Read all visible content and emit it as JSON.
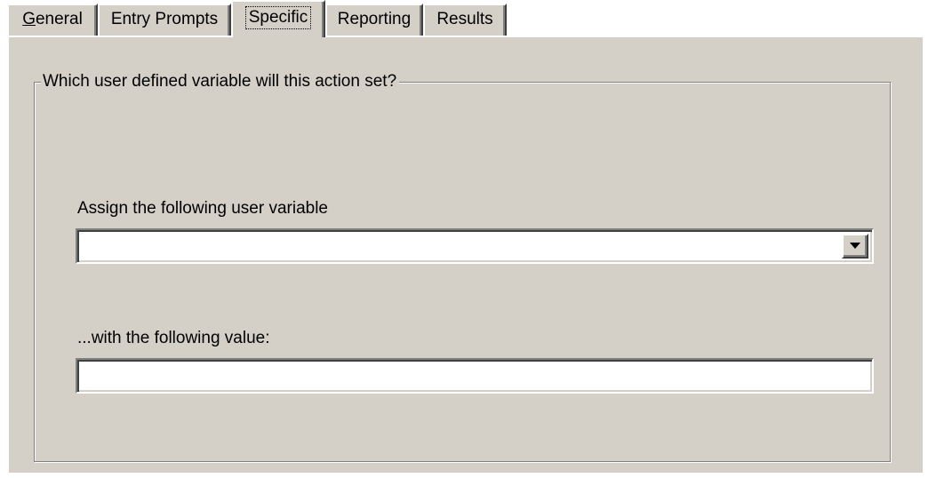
{
  "tabs": [
    {
      "label": "General",
      "selected": false,
      "underlined_letter": "G"
    },
    {
      "label": "Entry Prompts",
      "selected": false
    },
    {
      "label": "Specific",
      "selected": true
    },
    {
      "label": "Reporting",
      "selected": false
    },
    {
      "label": "Results",
      "selected": false
    }
  ],
  "group": {
    "title": "Which user defined variable will this action set?"
  },
  "variable_field": {
    "label": "Assign the following user variable",
    "value": ""
  },
  "value_field": {
    "label": "...with the following value:",
    "value": ""
  },
  "icons": {
    "dropdown": "chevron-down-icon"
  },
  "colors": {
    "face": "#d4d0c8",
    "highlight": "#ffffff",
    "shadow": "#808080",
    "dark_shadow": "#404040",
    "field_background": "#ffffff",
    "text": "#000000"
  }
}
